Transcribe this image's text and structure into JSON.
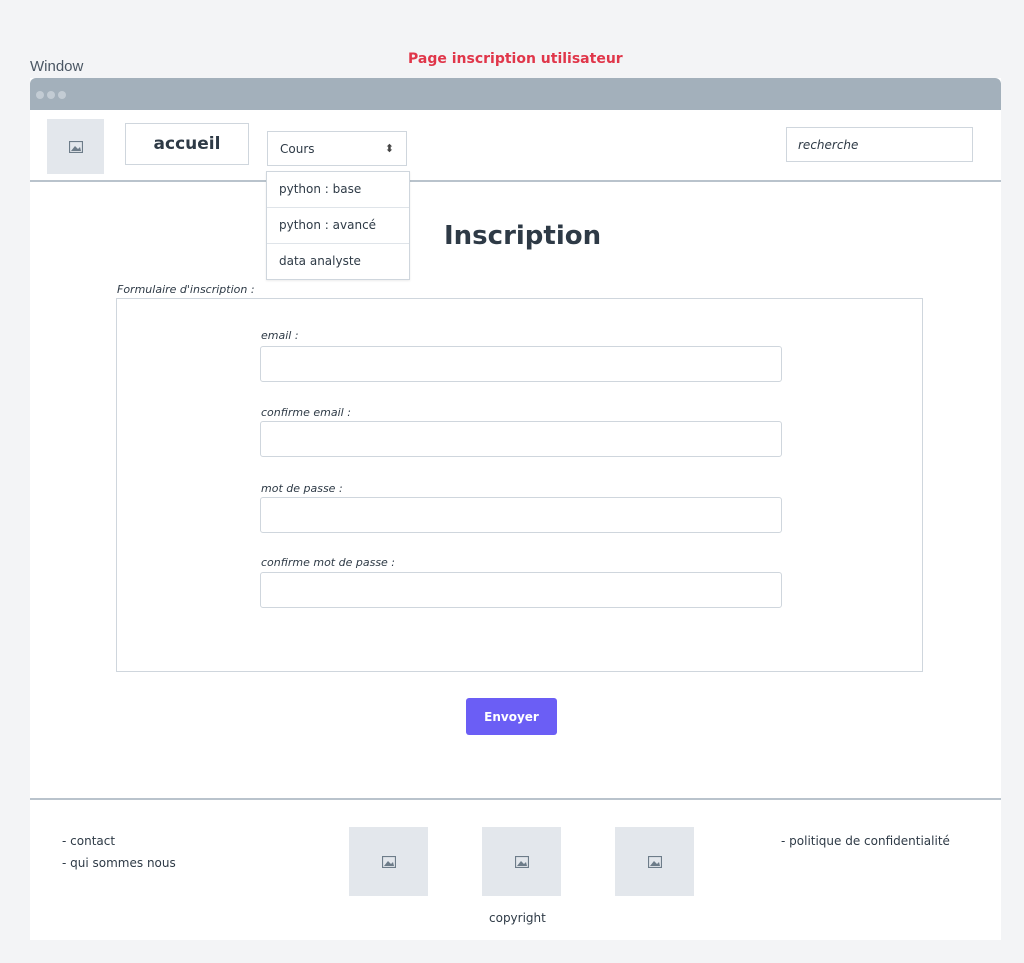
{
  "window_label": "Window",
  "page_title": "Page inscription utilisateur",
  "nav": {
    "logo_icon": "image-icon",
    "home_button": "accueil",
    "courses_select": {
      "value": "Cours",
      "options": [
        "python : base",
        "python : avancé",
        "data analyste"
      ]
    },
    "search_placeholder": "recherche"
  },
  "main": {
    "heading": "Inscription",
    "form_caption": "Formulaire d'inscription :",
    "fields": [
      {
        "label": "email :"
      },
      {
        "label": "confirme email :"
      },
      {
        "label": "mot de passe :"
      },
      {
        "label": "confirme mot de passe :"
      }
    ],
    "submit_label": "Envoyer"
  },
  "footer": {
    "links_left": [
      "- contact",
      "- qui sommes nous"
    ],
    "link_right": "- politique de confidentialité",
    "copyright": "copyright",
    "image_icons": [
      "image-icon",
      "image-icon",
      "image-icon"
    ]
  },
  "colors": {
    "title_red": "#e0364a",
    "submit_purple": "#6b5ef5",
    "titlebar": "#a3b0bb"
  }
}
